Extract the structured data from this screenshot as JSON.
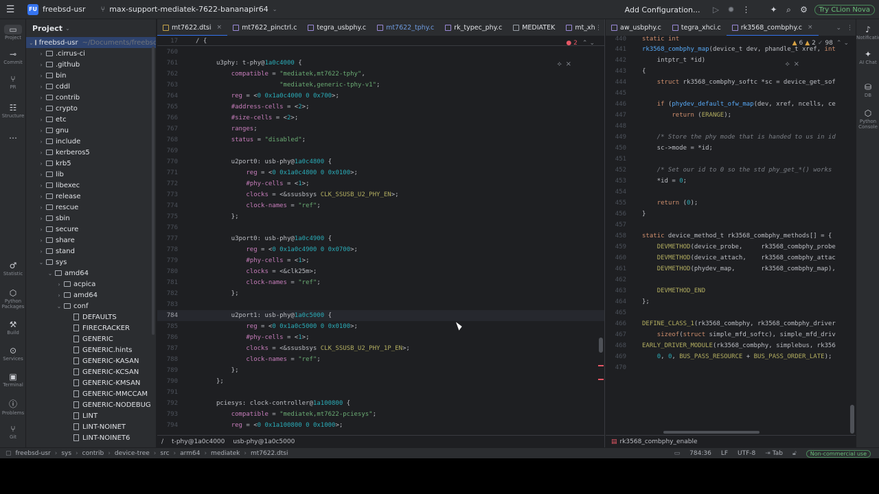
{
  "topbar": {
    "project_badge": "FU",
    "project_name": "freebsd-usr",
    "branch": "max-support-mediatek-7622-bananapir64",
    "add_configuration": "Add Configuration...",
    "try_clion": "Try CLion Nova"
  },
  "left_strip": [
    {
      "name": "project",
      "icon": "▭",
      "label": "Project"
    },
    {
      "name": "commit",
      "icon": "⊸",
      "label": "Commit"
    },
    {
      "name": "pull-requests",
      "icon": "⑂",
      "label": "PR"
    },
    {
      "name": "structure",
      "icon": "☷",
      "label": "Structure"
    },
    {
      "name": "more",
      "icon": "⋯",
      "label": ""
    },
    {
      "name": "statistic",
      "icon": "♂",
      "label": "Statistic"
    },
    {
      "name": "python-packages",
      "icon": "⬡",
      "label": "Python Packages"
    },
    {
      "name": "build",
      "icon": "⚒",
      "label": "Build"
    },
    {
      "name": "services",
      "icon": "⊙",
      "label": "Services"
    },
    {
      "name": "terminal",
      "icon": "▣",
      "label": "Terminal"
    },
    {
      "name": "problems",
      "icon": "ⓘ",
      "label": "Problems"
    },
    {
      "name": "git",
      "icon": "⑂",
      "label": "Git"
    }
  ],
  "right_strip": [
    {
      "name": "notifications",
      "icon": "♪",
      "label": "Notifications"
    },
    {
      "name": "ai-chat",
      "icon": "✦",
      "label": "AI Chat"
    },
    {
      "name": "db",
      "icon": "⛁",
      "label": "DB"
    },
    {
      "name": "python-console",
      "icon": "⬡",
      "label": "Python Console"
    }
  ],
  "project_panel": {
    "title": "Project",
    "tree": [
      {
        "indent": 0,
        "arrow": "⌄",
        "kind": "folder",
        "label": "freebsd-usr",
        "extra": "~/Documents/freebsd-usr",
        "selected": true
      },
      {
        "indent": 1,
        "arrow": "›",
        "kind": "folder",
        "label": ".cirrus-ci"
      },
      {
        "indent": 1,
        "arrow": "›",
        "kind": "folder",
        "label": ".github"
      },
      {
        "indent": 1,
        "arrow": "›",
        "kind": "folder",
        "label": "bin"
      },
      {
        "indent": 1,
        "arrow": "›",
        "kind": "folder",
        "label": "cddl"
      },
      {
        "indent": 1,
        "arrow": "›",
        "kind": "folder",
        "label": "contrib"
      },
      {
        "indent": 1,
        "arrow": "›",
        "kind": "folder",
        "label": "crypto"
      },
      {
        "indent": 1,
        "arrow": "›",
        "kind": "folder",
        "label": "etc"
      },
      {
        "indent": 1,
        "arrow": "›",
        "kind": "folder",
        "label": "gnu"
      },
      {
        "indent": 1,
        "arrow": "›",
        "kind": "folder",
        "label": "include"
      },
      {
        "indent": 1,
        "arrow": "›",
        "kind": "folder",
        "label": "kerberos5"
      },
      {
        "indent": 1,
        "arrow": "›",
        "kind": "folder",
        "label": "krb5"
      },
      {
        "indent": 1,
        "arrow": "›",
        "kind": "folder",
        "label": "lib"
      },
      {
        "indent": 1,
        "arrow": "›",
        "kind": "folder",
        "label": "libexec"
      },
      {
        "indent": 1,
        "arrow": "›",
        "kind": "folder",
        "label": "release"
      },
      {
        "indent": 1,
        "arrow": "›",
        "kind": "folder",
        "label": "rescue"
      },
      {
        "indent": 1,
        "arrow": "›",
        "kind": "folder",
        "label": "sbin"
      },
      {
        "indent": 1,
        "arrow": "›",
        "kind": "folder",
        "label": "secure"
      },
      {
        "indent": 1,
        "arrow": "›",
        "kind": "folder",
        "label": "share"
      },
      {
        "indent": 1,
        "arrow": "›",
        "kind": "folder",
        "label": "stand"
      },
      {
        "indent": 1,
        "arrow": "⌄",
        "kind": "folder",
        "label": "sys"
      },
      {
        "indent": 2,
        "arrow": "⌄",
        "kind": "folder",
        "label": "amd64"
      },
      {
        "indent": 3,
        "arrow": "›",
        "kind": "folder",
        "label": "acpica"
      },
      {
        "indent": 3,
        "arrow": "›",
        "kind": "folder",
        "label": "amd64"
      },
      {
        "indent": 3,
        "arrow": "⌄",
        "kind": "folder",
        "label": "conf"
      },
      {
        "indent": 4,
        "arrow": "",
        "kind": "file",
        "label": "DEFAULTS"
      },
      {
        "indent": 4,
        "arrow": "",
        "kind": "file",
        "label": "FIRECRACKER"
      },
      {
        "indent": 4,
        "arrow": "",
        "kind": "file",
        "label": "GENERIC"
      },
      {
        "indent": 4,
        "arrow": "",
        "kind": "file",
        "label": "GENERIC.hints"
      },
      {
        "indent": 4,
        "arrow": "",
        "kind": "file",
        "label": "GENERIC-KASAN"
      },
      {
        "indent": 4,
        "arrow": "",
        "kind": "file",
        "label": "GENERIC-KCSAN"
      },
      {
        "indent": 4,
        "arrow": "",
        "kind": "file",
        "label": "GENERIC-KMSAN"
      },
      {
        "indent": 4,
        "arrow": "",
        "kind": "file",
        "label": "GENERIC-MMCCAM"
      },
      {
        "indent": 4,
        "arrow": "",
        "kind": "file",
        "label": "GENERIC-NODEBUG"
      },
      {
        "indent": 4,
        "arrow": "",
        "kind": "file",
        "label": "LINT"
      },
      {
        "indent": 4,
        "arrow": "",
        "kind": "file",
        "label": "LINT-NOINET"
      },
      {
        "indent": 4,
        "arrow": "",
        "kind": "file",
        "label": "LINT-NOINET6"
      }
    ]
  },
  "editor_left": {
    "tabs": [
      {
        "label": "mt7622.dtsi",
        "icon": "mt",
        "active": true,
        "mod": false,
        "close": true
      },
      {
        "label": "mt7622_pinctrl.c",
        "icon": "c",
        "active": false,
        "mod": false,
        "close": false
      },
      {
        "label": "tegra_usbphy.c",
        "icon": "c",
        "active": false,
        "mod": false,
        "close": false
      },
      {
        "label": "mt7622_tphy.c",
        "icon": "c",
        "active": false,
        "mod": true,
        "close": false
      },
      {
        "label": "rk_typec_phy.c",
        "icon": "c",
        "active": false,
        "mod": false,
        "close": false
      },
      {
        "label": "MEDIATEK",
        "icon": "f",
        "active": false,
        "mod": false,
        "close": false
      },
      {
        "label": "mt_xh",
        "icon": "c",
        "active": false,
        "mod": false,
        "close": false
      }
    ],
    "sticky_line": {
      "num": "17",
      "text": "/ {"
    },
    "inspection": {
      "errors": "2"
    },
    "breadcrumb": [
      "/",
      "t-phy@1a0c4000",
      "usb-phy@1a0c5000"
    ],
    "lines": [
      {
        "num": "760",
        "text": ""
      },
      {
        "num": "761",
        "text": "u3phy: t-phy@1a0c4000 {"
      },
      {
        "num": "762",
        "text": "    compatible = \"mediatek,mt7622-tphy\","
      },
      {
        "num": "763",
        "text": "                 \"mediatek,generic-tphy-v1\";"
      },
      {
        "num": "764",
        "text": "    reg = <0 0x1a0c4000 0 0x700>;"
      },
      {
        "num": "765",
        "text": "    #address-cells = <2>;"
      },
      {
        "num": "766",
        "text": "    #size-cells = <2>;"
      },
      {
        "num": "767",
        "text": "    ranges;"
      },
      {
        "num": "768",
        "text": "    status = \"disabled\";"
      },
      {
        "num": "769",
        "text": ""
      },
      {
        "num": "770",
        "text": "    u2port0: usb-phy@1a0c4800 {"
      },
      {
        "num": "771",
        "text": "        reg = <0 0x1a0c4800 0 0x0100>;"
      },
      {
        "num": "772",
        "text": "        #phy-cells = <1>;"
      },
      {
        "num": "773",
        "text": "        clocks = <&ssusbsys CLK_SSUSB_U2_PHY_EN>;"
      },
      {
        "num": "774",
        "text": "        clock-names = \"ref\";"
      },
      {
        "num": "775",
        "text": "    };"
      },
      {
        "num": "776",
        "text": ""
      },
      {
        "num": "777",
        "text": "    u3port0: usb-phy@1a0c4900 {"
      },
      {
        "num": "778",
        "text": "        reg = <0 0x1a0c4900 0 0x0700>;"
      },
      {
        "num": "779",
        "text": "        #phy-cells = <1>;"
      },
      {
        "num": "780",
        "text": "        clocks = <&clk25m>;"
      },
      {
        "num": "781",
        "text": "        clock-names = \"ref\";"
      },
      {
        "num": "782",
        "text": "    };"
      },
      {
        "num": "783",
        "text": ""
      },
      {
        "num": "784",
        "text": "    u2port1: usb-phy@1a0c5000 {"
      },
      {
        "num": "785",
        "text": "        reg = <0 0x1a0c5000 0 0x0100>;"
      },
      {
        "num": "786",
        "text": "        #phy-cells = <1>;"
      },
      {
        "num": "787",
        "text": "        clocks = <&ssusbsys CLK_SSUSB_U2_PHY_1P_EN>;"
      },
      {
        "num": "788",
        "text": "        clock-names = \"ref\";"
      },
      {
        "num": "789",
        "text": "    };"
      },
      {
        "num": "790",
        "text": "};"
      },
      {
        "num": "791",
        "text": ""
      },
      {
        "num": "792",
        "text": "pciesys: clock-controller@1a100800 {"
      },
      {
        "num": "793",
        "text": "    compatible = \"mediatek,mt7622-pciesys\";"
      },
      {
        "num": "794",
        "text": "    reg = <0 0x1a100800 0 0x1000>;"
      }
    ]
  },
  "editor_right": {
    "tabs": [
      {
        "label": "aw_usbphy.c",
        "icon": "c",
        "active": false,
        "close": false
      },
      {
        "label": "tegra_xhci.c",
        "icon": "c",
        "active": false,
        "close": false
      },
      {
        "label": "rk3568_combphy.c",
        "icon": "c",
        "active": true,
        "close": true
      }
    ],
    "inspection": {
      "warnings": "6",
      "weak": "2",
      "typos": "98"
    },
    "breadcrumb": [
      "rk3568_combphy_enable"
    ],
    "sticky_line": {
      "num": "440",
      "text": "static int"
    },
    "lines": [
      {
        "num": "441",
        "text": "rk3568_combphy_map(device_t dev, phandle_t xref, int"
      },
      {
        "num": "442",
        "text": "    intptr_t *id)"
      },
      {
        "num": "443",
        "text": "{"
      },
      {
        "num": "444",
        "text": "    struct rk3568_combphy_softc *sc = device_get_sof"
      },
      {
        "num": "445",
        "text": ""
      },
      {
        "num": "446",
        "text": "    if (phydev_default_ofw_map(dev, xref, ncells, ce"
      },
      {
        "num": "447",
        "text": "        return (ERANGE);"
      },
      {
        "num": "448",
        "text": ""
      },
      {
        "num": "449",
        "text": "    /* Store the phy mode that is handed to us in id"
      },
      {
        "num": "450",
        "text": "    sc->mode = *id;"
      },
      {
        "num": "451",
        "text": ""
      },
      {
        "num": "452",
        "text": "    /* Set our id to 0 so the std phy_get_*() works"
      },
      {
        "num": "453",
        "text": "    *id = 0;"
      },
      {
        "num": "454",
        "text": ""
      },
      {
        "num": "455",
        "text": "    return (0);"
      },
      {
        "num": "456",
        "text": "}"
      },
      {
        "num": "457",
        "text": ""
      },
      {
        "num": "458",
        "text": "static device_method_t rk3568_combphy_methods[] = {"
      },
      {
        "num": "459",
        "text": "    DEVMETHOD(device_probe,     rk3568_combphy_probe"
      },
      {
        "num": "460",
        "text": "    DEVMETHOD(device_attach,    rk3568_combphy_attac"
      },
      {
        "num": "461",
        "text": "    DEVMETHOD(phydev_map,       rk3568_combphy_map),"
      },
      {
        "num": "462",
        "text": ""
      },
      {
        "num": "463",
        "text": "    DEVMETHOD_END"
      },
      {
        "num": "464",
        "text": "};"
      },
      {
        "num": "465",
        "text": ""
      },
      {
        "num": "466",
        "text": "DEFINE_CLASS_1(rk3568_combphy, rk3568_combphy_driver"
      },
      {
        "num": "467",
        "text": "    sizeof(struct simple_mfd_softc), simple_mfd_driv"
      },
      {
        "num": "468",
        "text": "EARLY_DRIVER_MODULE(rk3568_combphy, simplebus, rk356"
      },
      {
        "num": "469",
        "text": "    0, 0, BUS_PASS_RESOURCE + BUS_PASS_ORDER_LATE);"
      },
      {
        "num": "470",
        "text": ""
      }
    ]
  },
  "statusbar": {
    "crumbs": [
      "freebsd-usr",
      "sys",
      "contrib",
      "device-tree",
      "src",
      "arm64",
      "mediatek",
      "mt7622.dtsi"
    ],
    "position": "784:36",
    "line_ending": "LF",
    "encoding": "UTF-8",
    "indent": "Tab",
    "license": "Non-commercial use"
  }
}
